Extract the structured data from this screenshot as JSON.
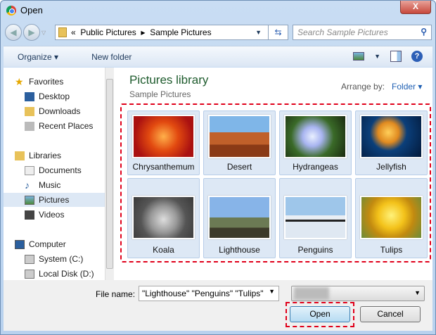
{
  "window": {
    "title": "Open",
    "close": "X"
  },
  "address": {
    "overflow": "«",
    "crumbs": [
      "Public Pictures",
      "Sample Pictures"
    ],
    "search_placeholder": "Search Sample Pictures"
  },
  "toolbar": {
    "organize": "Organize ▾",
    "new_folder": "New folder"
  },
  "sidebar": {
    "items": [
      {
        "label": "Favorites",
        "type": "header"
      },
      {
        "label": "Desktop"
      },
      {
        "label": "Downloads"
      },
      {
        "label": "Recent Places"
      },
      {
        "label": "Libraries",
        "type": "header"
      },
      {
        "label": "Documents"
      },
      {
        "label": "Music"
      },
      {
        "label": "Pictures",
        "selected": true
      },
      {
        "label": "Videos"
      },
      {
        "label": "Computer",
        "type": "header"
      },
      {
        "label": "System (C:)"
      },
      {
        "label": "Local Disk (D:)"
      }
    ]
  },
  "main": {
    "title": "Pictures library",
    "subtitle": "Sample Pictures",
    "arrange_label": "Arrange by:",
    "arrange_value": "Folder ▾",
    "files": [
      {
        "name": "Chrysanthemum"
      },
      {
        "name": "Desert"
      },
      {
        "name": "Hydrangeas"
      },
      {
        "name": "Jellyfish"
      },
      {
        "name": "Koala"
      },
      {
        "name": "Lighthouse"
      },
      {
        "name": "Penguins"
      },
      {
        "name": "Tulips"
      }
    ]
  },
  "footer": {
    "file_name_label": "File name:",
    "file_name_value": "\"Lighthouse\" \"Penguins\" \"Tulips\"",
    "open": "Open",
    "cancel": "Cancel"
  },
  "colors": {
    "highlight": "#e0001a",
    "title_green": "#1e5b2d"
  }
}
